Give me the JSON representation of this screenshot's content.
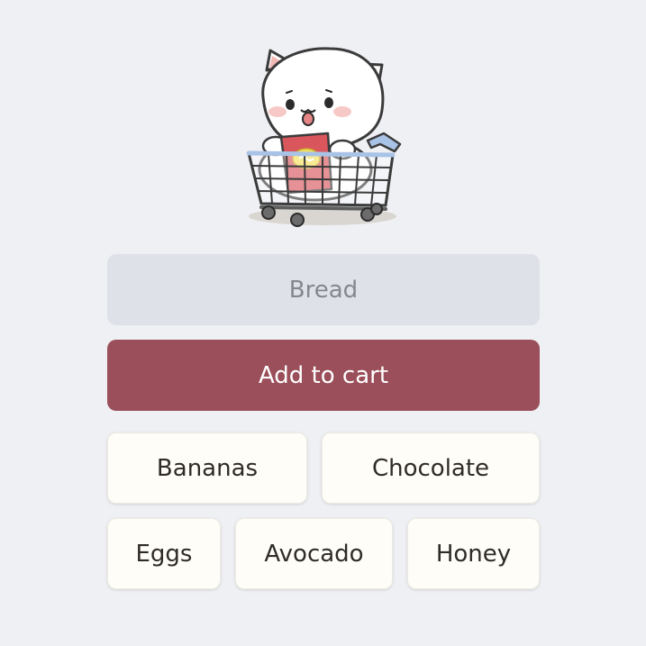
{
  "hero": {
    "icon": "cat-in-shopping-cart-icon"
  },
  "item_input": {
    "placeholder": "Bread",
    "value": ""
  },
  "add_button": {
    "label": "Add to cart"
  },
  "suggestions": [
    {
      "label": "Bananas"
    },
    {
      "label": "Chocolate"
    },
    {
      "label": "Eggs"
    },
    {
      "label": "Avocado"
    },
    {
      "label": "Honey"
    }
  ],
  "colors": {
    "background": "#eff0f4",
    "input_background": "#dfe1e9",
    "accent": "#9a4f5a",
    "chip_background": "#fefdf8"
  }
}
